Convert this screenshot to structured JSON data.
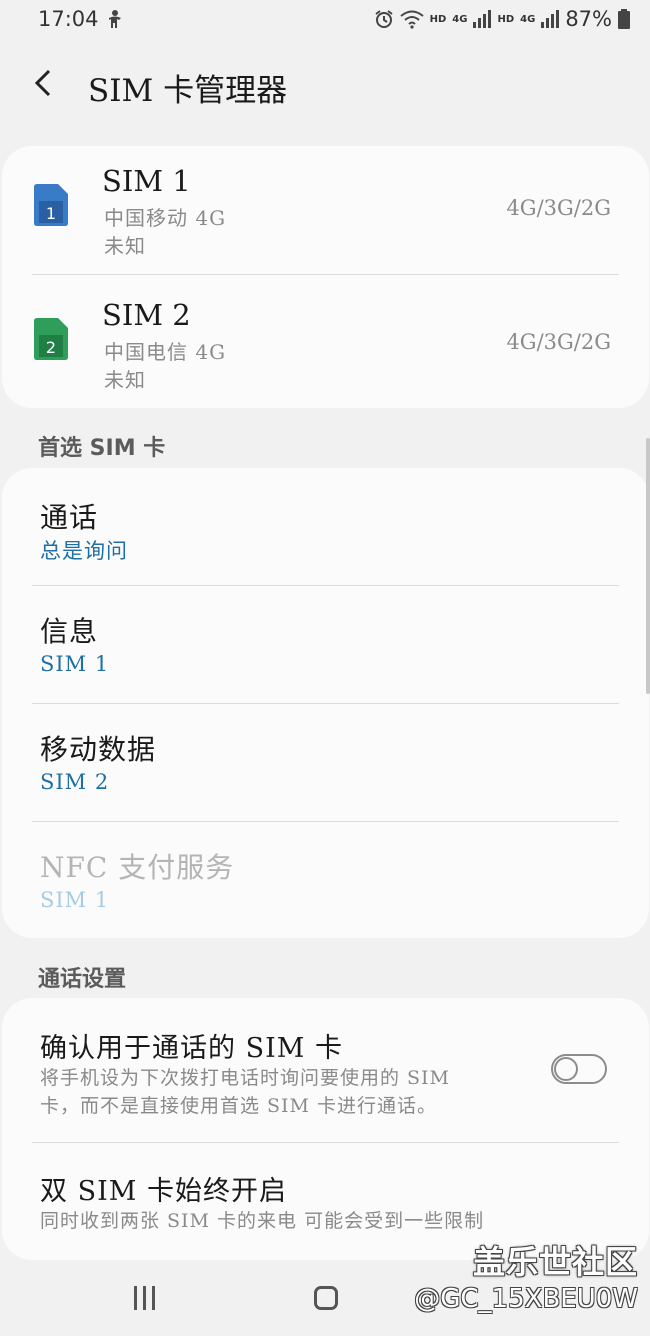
{
  "status_bar": {
    "time": "17:04",
    "hd1": "HD",
    "net1": "4G",
    "hd2": "HD",
    "net2": "4G",
    "battery": "87%"
  },
  "header": {
    "title": "SIM 卡管理器"
  },
  "sim_cards": [
    {
      "name": "SIM 1",
      "icon_number": "1",
      "carrier": "中国移动 4G",
      "status": "未知",
      "network": "4G/3G/2G",
      "color": "#3a7bc8"
    },
    {
      "name": "SIM 2",
      "icon_number": "2",
      "carrier": "中国电信 4G",
      "status": "未知",
      "network": "4G/3G/2G",
      "color": "#2e9e5a"
    }
  ],
  "preferred": {
    "label": "首选 SIM 卡",
    "items": [
      {
        "title": "通话",
        "value": "总是询问"
      },
      {
        "title": "信息",
        "value": "SIM 1"
      },
      {
        "title": "移动数据",
        "value": "SIM 2"
      },
      {
        "title": "NFC 支付服务",
        "value": "SIM 1"
      }
    ]
  },
  "call_settings": {
    "label": "通话设置",
    "confirm": {
      "title": "确认用于通话的 SIM 卡",
      "desc_line1": "将手机设为下次拨打电话时询问要使用的 SIM",
      "desc_line2": "卡，而不是直接使用首选 SIM 卡进行通话。",
      "toggle_on": false
    },
    "dual": {
      "title": "双 SIM 卡始终开启",
      "desc": "同时收到两张 SIM 卡的来电 可能会受到一些限制"
    }
  },
  "watermark": {
    "brand": "盖乐世社区",
    "user": "@GC_15XBEU0W"
  },
  "colors": {
    "accent": "#1d6fa5",
    "background": "#f1f1f1",
    "card": "#fbfbfb"
  }
}
